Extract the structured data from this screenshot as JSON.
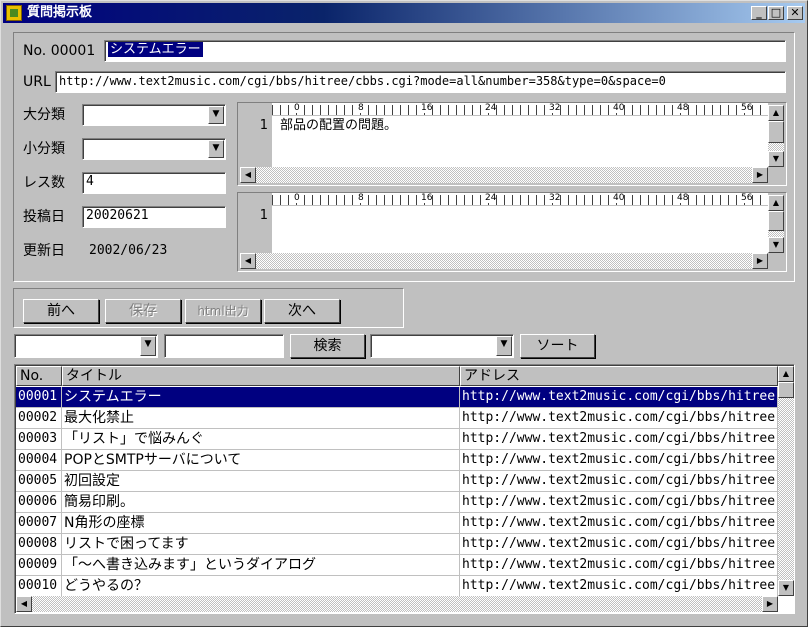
{
  "window": {
    "title": "質問掲示板",
    "minimize_glyph": "_",
    "maximize_glyph": "□",
    "close_glyph": "✕"
  },
  "form": {
    "no_label": "No. 00001",
    "title_value": "システムエラー",
    "url_label": "URL",
    "url_value": "http://www.text2music.com/cgi/bbs/hitree/cbbs.cgi?mode=all&number=358&type=0&space=0",
    "category_label": "大分類",
    "category_value": "",
    "subcategory_label": "小分類",
    "subcategory_value": "",
    "reply_count_label": "レス数",
    "reply_count_value": "4",
    "posted_label": "投稿日",
    "posted_value": "20020621",
    "updated_label": "更新日",
    "updated_value": "2002/06/23"
  },
  "editor1": {
    "line_number": "1",
    "text": "部品の配置の問題。",
    "ruler_marks": [
      "0",
      "8",
      "16",
      "24",
      "32",
      "40",
      "48",
      "56"
    ]
  },
  "editor2": {
    "line_number": "1",
    "text": "",
    "ruler_marks": [
      "0",
      "8",
      "16",
      "24",
      "32",
      "40",
      "48",
      "56"
    ]
  },
  "buttons": {
    "prev": "前へ",
    "save": "保存",
    "html": "html出力",
    "next": "次へ",
    "search": "検索",
    "sort": "ソート"
  },
  "filters": {
    "field_select": "",
    "search_text": "",
    "sort_select": ""
  },
  "table": {
    "columns": [
      "No.",
      "タイトル",
      "アドレス"
    ],
    "rows": [
      {
        "no": "00001",
        "title": "システムエラー",
        "address": "http://www.text2music.com/cgi/bbs/hitree"
      },
      {
        "no": "00002",
        "title": "最大化禁止",
        "address": "http://www.text2music.com/cgi/bbs/hitree"
      },
      {
        "no": "00003",
        "title": "「リスト」で悩みんぐ",
        "address": "http://www.text2music.com/cgi/bbs/hitree"
      },
      {
        "no": "00004",
        "title": "POPとSMTPサーバについて",
        "address": "http://www.text2music.com/cgi/bbs/hitree"
      },
      {
        "no": "00005",
        "title": "初回設定",
        "address": "http://www.text2music.com/cgi/bbs/hitree"
      },
      {
        "no": "00006",
        "title": "簡易印刷。",
        "address": "http://www.text2music.com/cgi/bbs/hitree"
      },
      {
        "no": "00007",
        "title": "N角形の座標",
        "address": "http://www.text2music.com/cgi/bbs/hitree"
      },
      {
        "no": "00008",
        "title": "リストで困ってます",
        "address": "http://www.text2music.com/cgi/bbs/hitree"
      },
      {
        "no": "00009",
        "title": "「〜へ書き込みます」というダイアログ",
        "address": "http://www.text2music.com/cgi/bbs/hitree"
      },
      {
        "no": "00010",
        "title": "どうやるの？",
        "address": "http://www.text2music.com/cgi/bbs/hitree"
      }
    ]
  },
  "colors": {
    "face": "#c0c0c0",
    "selection": "#000080",
    "title_start": "#000080",
    "title_end": "#a6caf0"
  }
}
